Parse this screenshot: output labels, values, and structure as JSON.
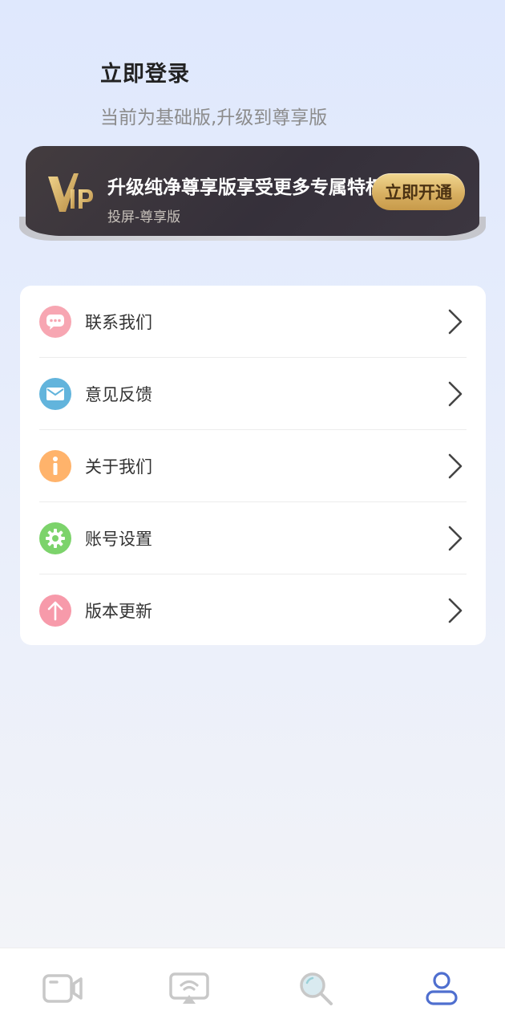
{
  "header": {
    "title": "立即登录",
    "subtitle": "当前为基础版,升级到尊享版"
  },
  "vip": {
    "logo": "vip-logo",
    "title": "升级纯净尊享版享受更多专属特权",
    "subtitle": "投屏-尊享版",
    "button_label": "立即开通",
    "colors": {
      "card": "#3a343c",
      "gold": "#d8b062"
    }
  },
  "menu": {
    "items": [
      {
        "label": "联系我们",
        "icon": "chat-bubble-icon",
        "color": "#f7a6b2"
      },
      {
        "label": "意见反馈",
        "icon": "envelope-icon",
        "color": "#62b4dc"
      },
      {
        "label": "关于我们",
        "icon": "info-icon",
        "color": "#ffb36b"
      },
      {
        "label": "账号设置",
        "icon": "gear-icon",
        "color": "#7cd36b"
      },
      {
        "label": "版本更新",
        "icon": "arrow-up-icon",
        "color": "#f79aaa"
      }
    ]
  },
  "tabbar": {
    "tabs": [
      {
        "icon": "camera-icon",
        "active": false
      },
      {
        "icon": "screen-cast-icon",
        "active": false
      },
      {
        "icon": "search-icon",
        "active": false
      },
      {
        "icon": "user-icon",
        "active": true
      }
    ],
    "colors": {
      "active": "#4f6fcf",
      "inactive": "#c8c8c8"
    }
  }
}
